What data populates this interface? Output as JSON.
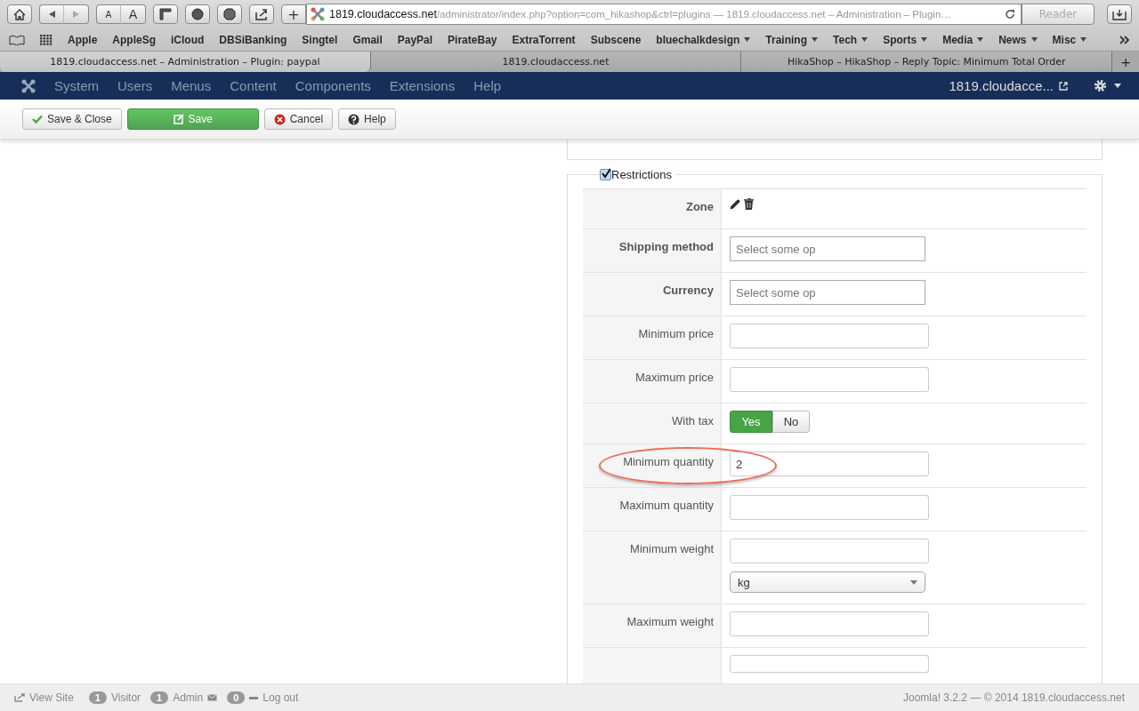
{
  "browser": {
    "text_size_buttons": [
      "A",
      "A"
    ],
    "new_tab_button": "+",
    "address": {
      "host": "1819.cloudaccess.net",
      "rest": "/administrator/index.php?option=com_hikashop&ctrl=plugins — 1819.cloudaccess.net – Administration – Plugin…"
    },
    "reader_button": {
      "label": "Reader",
      "disabled": true
    },
    "bookmarks": [
      {
        "label": "Apple",
        "menu": false
      },
      {
        "label": "AppleSg",
        "menu": false
      },
      {
        "label": "iCloud",
        "menu": false
      },
      {
        "label": "DBSiBanking",
        "menu": false
      },
      {
        "label": "Singtel",
        "menu": false
      },
      {
        "label": "Gmail",
        "menu": false
      },
      {
        "label": "PayPal",
        "menu": false
      },
      {
        "label": "PirateBay",
        "menu": false
      },
      {
        "label": "ExtraTorrent",
        "menu": false
      },
      {
        "label": "Subscene",
        "menu": false
      },
      {
        "label": "bluechalkdesign",
        "menu": true
      },
      {
        "label": "Training",
        "menu": true
      },
      {
        "label": "Tech",
        "menu": true
      },
      {
        "label": "Sports",
        "menu": true
      },
      {
        "label": "Media",
        "menu": true
      },
      {
        "label": "News",
        "menu": true
      },
      {
        "label": "Misc",
        "menu": true
      }
    ],
    "tabs": [
      {
        "title": "1819.cloudaccess.net – Administration – Plugin: paypal",
        "selected": true
      },
      {
        "title": "1819.cloudaccess.net",
        "selected": false
      },
      {
        "title": "HikaShop – HikaShop – Reply Topic: Minimum Total Order",
        "selected": false
      }
    ],
    "add_tab_button": "+"
  },
  "admin_menu": {
    "items": [
      "System",
      "Users",
      "Menus",
      "Content",
      "Components",
      "Extensions",
      "Help"
    ],
    "site_link": "1819.cloudacce..."
  },
  "toolbar": [
    {
      "label": "Save & Close",
      "kind": "save_close"
    },
    {
      "label": "Save",
      "kind": "save"
    },
    {
      "label": "Cancel",
      "kind": "cancel"
    },
    {
      "label": "Help",
      "kind": "help"
    }
  ],
  "restrictions": {
    "legend": "Restrictions",
    "checked": true,
    "rows": [
      {
        "label": "Zone",
        "bold": true,
        "kind": "icons"
      },
      {
        "label": "Shipping method",
        "bold": true,
        "kind": "select",
        "placeholder": "Select some op"
      },
      {
        "label": "Currency",
        "bold": true,
        "kind": "select",
        "placeholder": "Select some op"
      },
      {
        "label": "Minimum price",
        "bold": false,
        "kind": "input"
      },
      {
        "label": "Maximum price",
        "bold": false,
        "kind": "input"
      },
      {
        "label": "With tax",
        "bold": false,
        "kind": "toggle",
        "options": [
          {
            "label": "Yes",
            "selected": true
          },
          {
            "label": "No",
            "selected": false
          }
        ]
      },
      {
        "label": "Minimum quantity",
        "bold": false,
        "kind": "input",
        "value": "2",
        "highlighted": true
      },
      {
        "label": "Maximum quantity",
        "bold": false,
        "kind": "input"
      },
      {
        "label": "Minimum weight",
        "bold": false,
        "kind": "input_unit",
        "unit": "kg"
      },
      {
        "label": "Maximum weight",
        "bold": false,
        "kind": "input"
      }
    ]
  },
  "footer": {
    "view_site": "View Site",
    "visitors": "1",
    "visitors_label": "Visitor",
    "admins": "1",
    "admins_label": "Admin",
    "messages": "0",
    "logout": "Log out",
    "version": "Joomla! 3.2.2  —  © 2014 1819.cloudaccess.net"
  }
}
